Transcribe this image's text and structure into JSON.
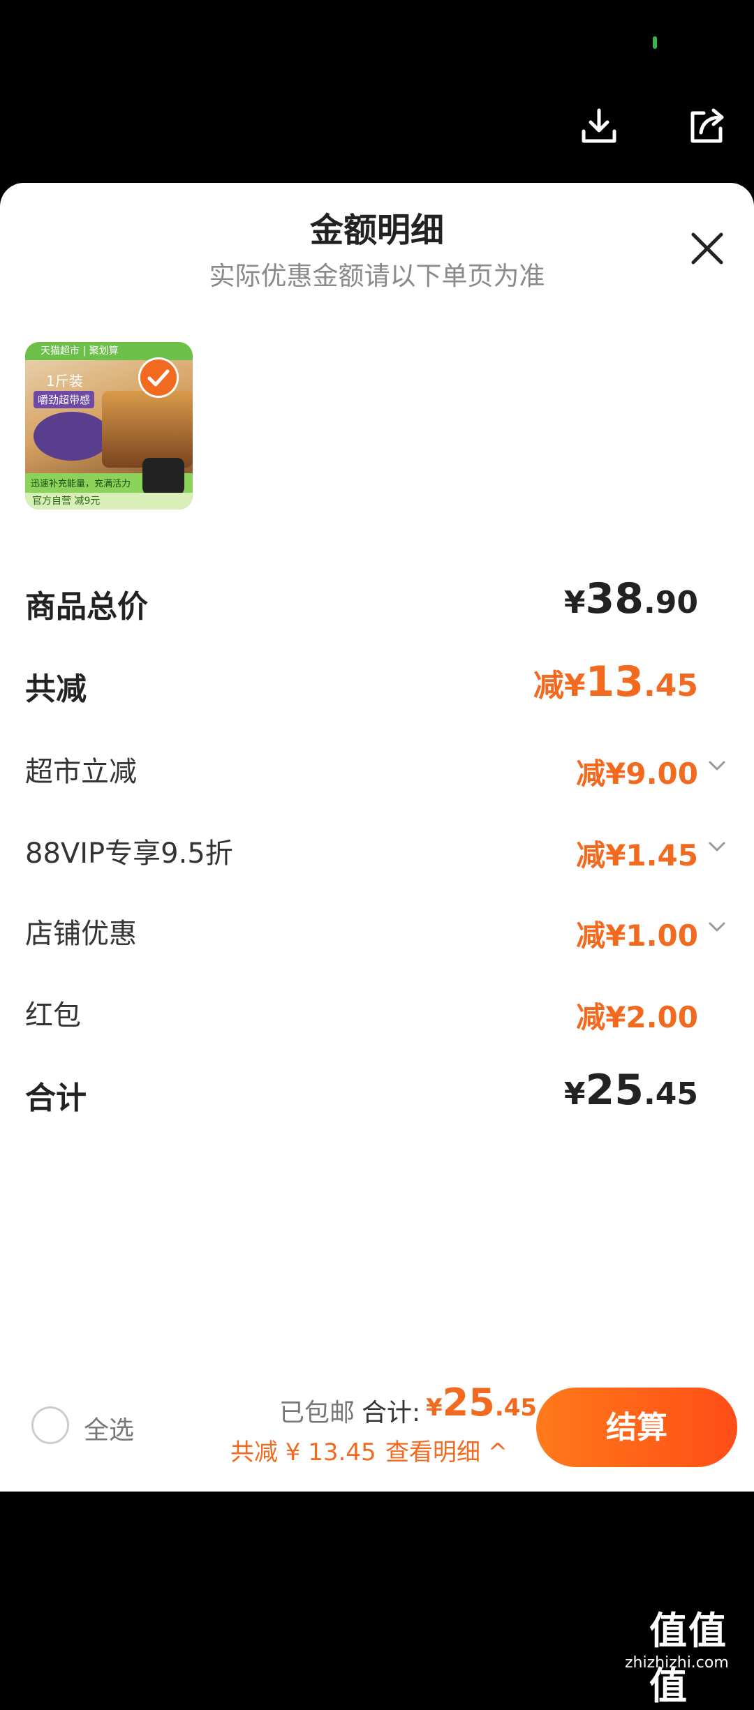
{
  "colors": {
    "accent": "#f26a1f",
    "checkout_start": "#ff7a1a",
    "checkout_end": "#ff4d17"
  },
  "top_bar": {
    "icons": [
      "download-icon",
      "share-icon"
    ]
  },
  "sheet": {
    "title": "金额明细",
    "subtitle": "实际优惠金额请以下单页为准",
    "close_icon": "close-icon"
  },
  "product": {
    "thumb_top": "天猫超市 | 聚划算",
    "thumb_text1": "1斤装",
    "thumb_text2": "嚼劲超带感",
    "thumb_bottom": "迅速补充能量，充满活力",
    "thumb_badge": "官方自营 减9元",
    "selected": true
  },
  "rows": {
    "subtotal": {
      "label": "商品总价",
      "prefix": "",
      "sym": "¥",
      "int": "38",
      "dec": ".90"
    },
    "discount": {
      "label": "共减",
      "prefix": "减",
      "sym": "¥",
      "int": "13",
      "dec": ".45"
    },
    "items": [
      {
        "label": "超市立减",
        "value": "减¥9.00",
        "expandable": true
      },
      {
        "label": "88VIP专享9.5折",
        "value": "减¥1.45",
        "expandable": true
      },
      {
        "label": "店铺优惠",
        "value": "减¥1.00",
        "expandable": true
      },
      {
        "label": "红包",
        "value": "减¥2.00",
        "expandable": false
      }
    ],
    "total": {
      "label": "合计",
      "prefix": "",
      "sym": "¥",
      "int": "25",
      "dec": ".45"
    }
  },
  "footer": {
    "select_all": "全选",
    "shipping": "已包邮",
    "total_label": "合计:",
    "total_sym": "¥",
    "total_int": "25",
    "total_dec": ".45",
    "saved": "共减 ¥ 13.45",
    "detail_link": "查看明细 ^",
    "checkout": "结算"
  },
  "watermark": {
    "logo": "值值值",
    "url": "zhizhizhi.com"
  }
}
